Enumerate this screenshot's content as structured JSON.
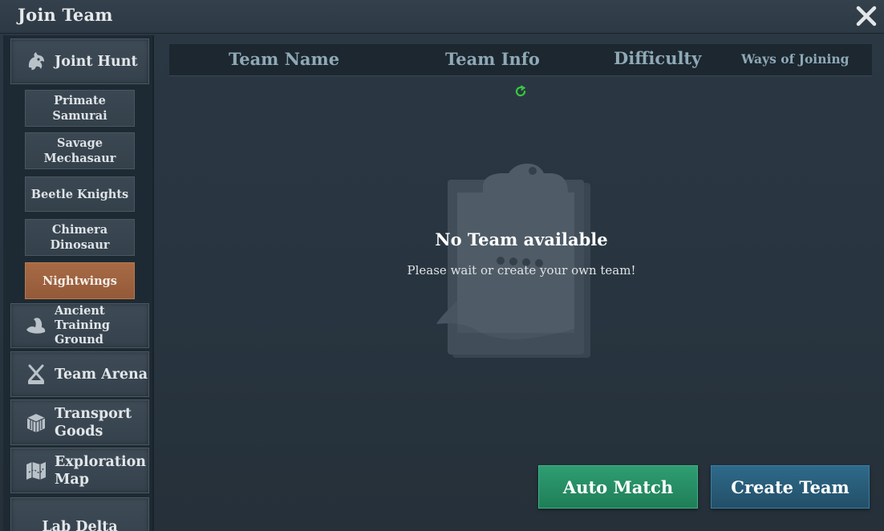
{
  "window": {
    "title": "Join Team"
  },
  "sidebar": {
    "categories": [
      {
        "label": "Joint Hunt",
        "icon": "beast-head-icon"
      },
      {
        "label": "Ancient Training Ground",
        "icon": "flexed-arm-icon"
      },
      {
        "label": "Team Arena",
        "icon": "crossed-swords-icon"
      },
      {
        "label": "Transport Goods",
        "icon": "crate-icon"
      },
      {
        "label": "Exploration Map",
        "icon": "map-icon"
      },
      {
        "label": "Lab Delta"
      }
    ],
    "subitems": [
      {
        "label": "Primate Samurai"
      },
      {
        "label": "Savage Mechasaur"
      },
      {
        "label": "Beetle Knights"
      },
      {
        "label": "Chimera Dinosaur"
      },
      {
        "label": "Nightwings",
        "selected": true
      }
    ]
  },
  "table": {
    "columns": [
      "Team Name",
      "Team Info",
      "Difficulty",
      "Ways of Joining"
    ]
  },
  "empty_state": {
    "title": "No Team available",
    "message": "Please wait or create your own team!",
    "icon": "clipboard-icon"
  },
  "actions": {
    "auto_match": "Auto Match",
    "create_team": "Create Team"
  },
  "colors": {
    "selected_tab": "#a86a45",
    "auto_match": "#2f9d72",
    "create_team": "#2e6a8a",
    "loading_spinner": "#35c93c"
  }
}
